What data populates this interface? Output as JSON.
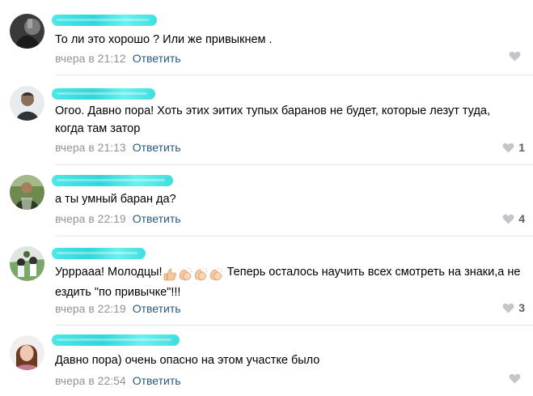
{
  "colors": {
    "link": "#2a5885",
    "meta": "#939393",
    "heart": "#c1c6cc",
    "divider": "#e7e8ec",
    "redaction": "#22d8dc"
  },
  "comments": [
    {
      "text": "То ли это хорошо ? Или же привыкнем .",
      "date": "вчера в 21:12",
      "reply": "Ответить",
      "likes": "",
      "icon": "heart-icon"
    },
    {
      "text": "Огоо. Давно пора! Хоть этих эитих тупых баранов не будет, которые лезут туда, когда там затор",
      "date": "вчера в 21:13",
      "reply": "Ответить",
      "likes": "1",
      "icon": "heart-icon"
    },
    {
      "text": "а ты умный баран да?",
      "date": "вчера в 22:19",
      "reply": "Ответить",
      "likes": "4",
      "icon": "heart-icon"
    },
    {
      "text_before": "Урррааа! Молодцы!",
      "text_after": " Теперь осталось научить всех смотреть на знаки,а не ездить \"по привычке\"!!!",
      "emojis": [
        "thumbs-up-emoji",
        "clapping-hands-emoji",
        "clapping-hands-emoji",
        "clapping-hands-emoji"
      ],
      "date": "вчера в 22:19",
      "reply": "Ответить",
      "likes": "3",
      "icon": "heart-icon"
    },
    {
      "text": "Давно пора) очень опасно на этом участке было",
      "date": "вчера в 22:54",
      "reply": "Ответить",
      "likes": "",
      "icon": "heart-icon"
    }
  ]
}
